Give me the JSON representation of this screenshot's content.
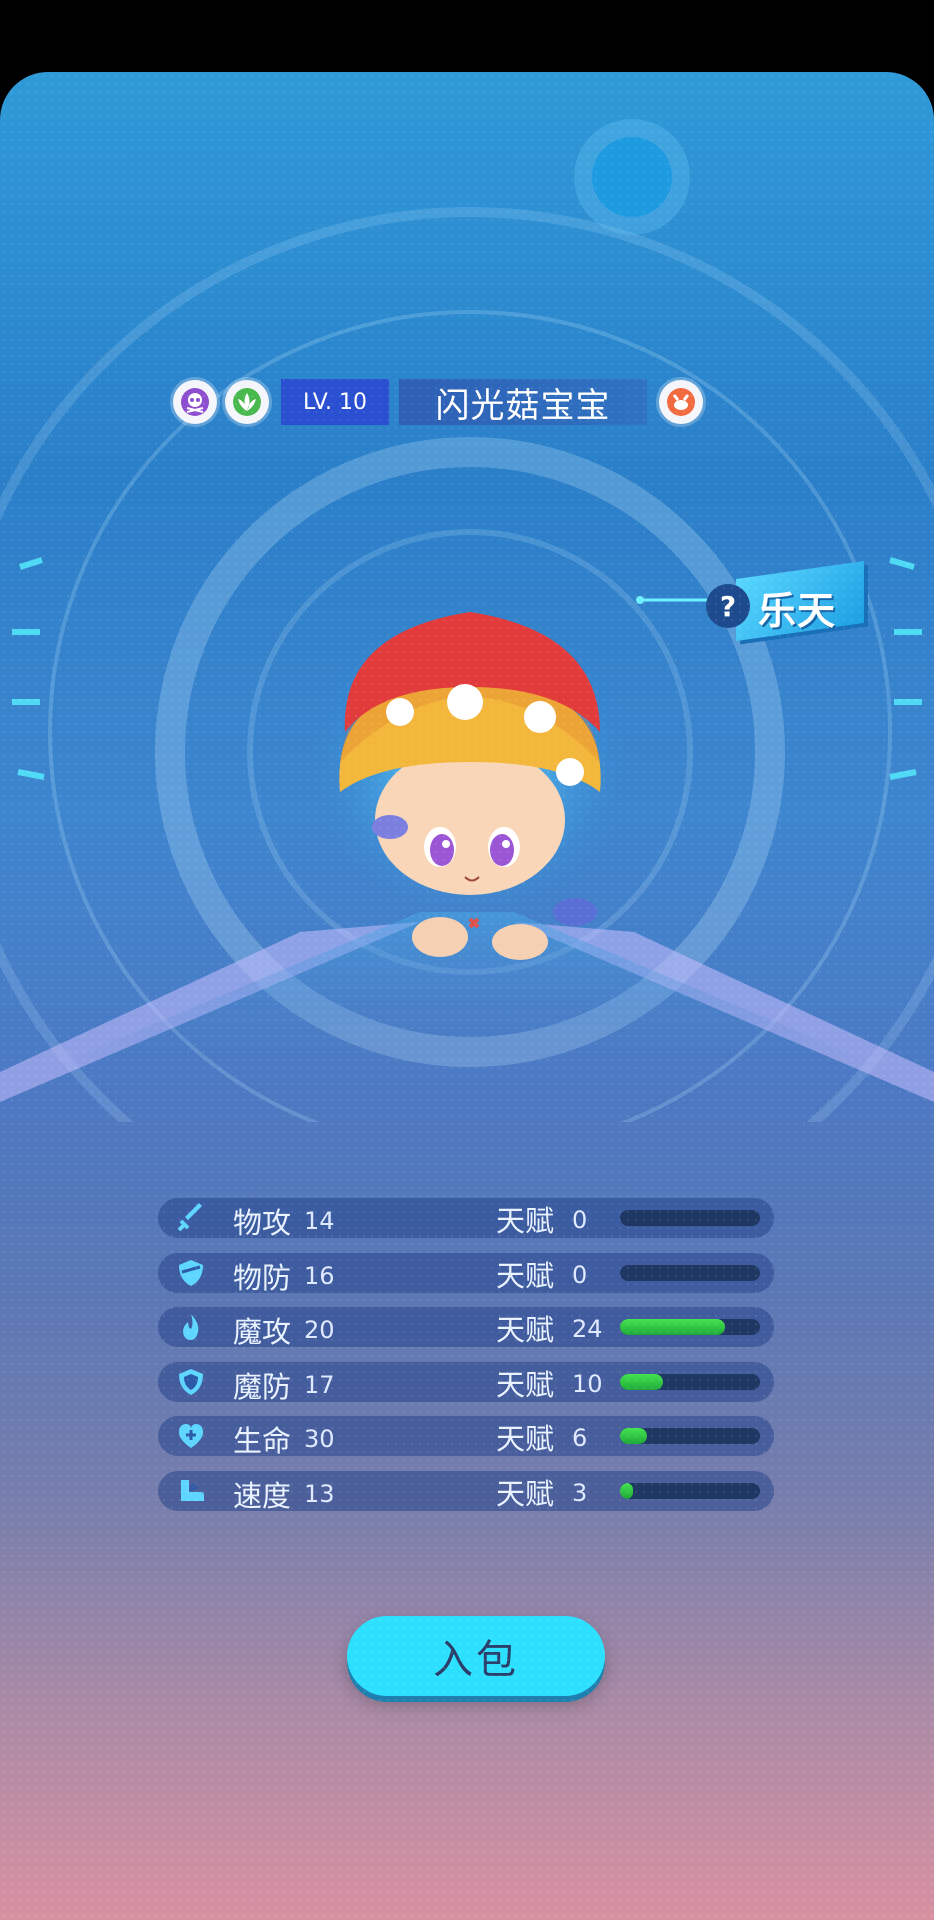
{
  "pet": {
    "level": "LV. 10",
    "name": "闪光菇宝宝",
    "badges": [
      "poison-skull-icon",
      "grass-leaf-icon",
      "fox-face-icon"
    ],
    "owner_tag": "乐天",
    "owner_tag_prefix": "?"
  },
  "stats": [
    {
      "icon": "sword-icon",
      "name": "物攻",
      "value": "14",
      "talent_label": "天赋",
      "talent": "0",
      "fill": 0.0
    },
    {
      "icon": "shield-icon",
      "name": "物防",
      "value": "16",
      "talent_label": "天赋",
      "talent": "0",
      "fill": 0.0
    },
    {
      "icon": "flame-icon",
      "name": "魔攻",
      "value": "20",
      "talent_label": "天赋",
      "talent": "24",
      "fill": 0.75
    },
    {
      "icon": "magic-shield-icon",
      "name": "魔防",
      "value": "17",
      "talent_label": "天赋",
      "talent": "10",
      "fill": 0.31
    },
    {
      "icon": "heart-plus-icon",
      "name": "生命",
      "value": "30",
      "talent_label": "天赋",
      "talent": "6",
      "fill": 0.19
    },
    {
      "icon": "speed-boot-icon",
      "name": "速度",
      "value": "13",
      "talent_label": "天赋",
      "talent": "3",
      "fill": 0.09
    }
  ],
  "actions": {
    "bag_button": "入包"
  },
  "colors": {
    "accent": "#2ee0ff",
    "bar_fill": "#2fc746",
    "bar_track": "#1f3763"
  }
}
